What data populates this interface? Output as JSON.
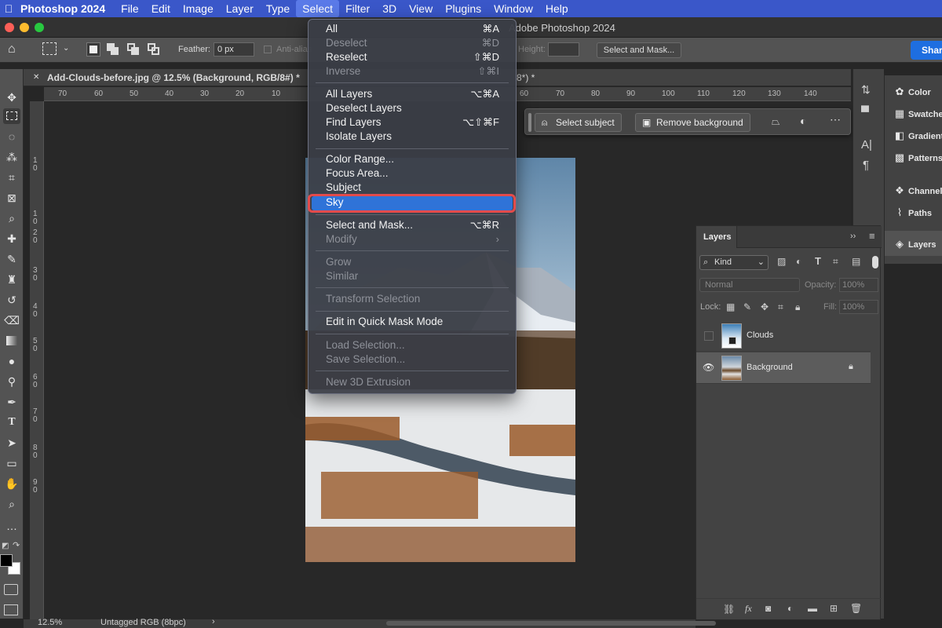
{
  "menubar": {
    "app_name": "Photoshop 2024",
    "items": [
      "File",
      "Edit",
      "Image",
      "Layer",
      "Type",
      "Select",
      "Filter",
      "3D",
      "View",
      "Plugins",
      "Window",
      "Help"
    ],
    "active": "Select"
  },
  "window": {
    "title": "Adobe Photoshop 2024"
  },
  "options_bar": {
    "feather_label": "Feather:",
    "feather_value": "0 px",
    "antialias_label": "Anti-alias",
    "height_label": "Height:",
    "select_mask_label": "Select and Mask...",
    "share_label": "Share"
  },
  "document": {
    "tab_title": "Add-Clouds-before.jpg @ 12.5% (Background, RGB/8#) *",
    "tab2_suffix": "8*) *"
  },
  "rulers": {
    "horizontal": [
      "70",
      "60",
      "50",
      "40",
      "30",
      "20",
      "10",
      "60",
      "70",
      "80",
      "90",
      "100",
      "110",
      "120",
      "130",
      "140"
    ],
    "vertical": [
      "1",
      "0",
      "1",
      "0",
      "2",
      "0",
      "3",
      "0",
      "4",
      "0",
      "5",
      "0",
      "6",
      "0",
      "7",
      "0",
      "8",
      "0",
      "9",
      "0"
    ]
  },
  "contextual_taskbar": {
    "select_subject": "Select subject",
    "remove_background": "Remove background"
  },
  "select_menu": {
    "items": [
      {
        "label": "All",
        "shortcut": "⌘A",
        "disabled": false
      },
      {
        "label": "Deselect",
        "shortcut": "⌘D",
        "disabled": true
      },
      {
        "label": "Reselect",
        "shortcut": "⇧⌘D",
        "disabled": false
      },
      {
        "label": "Inverse",
        "shortcut": "⇧⌘I",
        "disabled": true
      },
      {
        "label": "All Layers",
        "shortcut": "⌥⌘A",
        "disabled": false
      },
      {
        "label": "Deselect Layers",
        "shortcut": "",
        "disabled": false
      },
      {
        "label": "Find Layers",
        "shortcut": "⌥⇧⌘F",
        "disabled": false
      },
      {
        "label": "Isolate Layers",
        "shortcut": "",
        "disabled": false
      },
      {
        "label": "Color Range...",
        "shortcut": "",
        "disabled": false
      },
      {
        "label": "Focus Area...",
        "shortcut": "",
        "disabled": false
      },
      {
        "label": "Subject",
        "shortcut": "",
        "disabled": false
      },
      {
        "label": "Sky",
        "shortcut": "",
        "disabled": false,
        "highlighted": true
      },
      {
        "label": "Select and Mask...",
        "shortcut": "⌥⌘R",
        "disabled": false
      },
      {
        "label": "Modify",
        "shortcut": "›",
        "disabled": true
      },
      {
        "label": "Grow",
        "shortcut": "",
        "disabled": true
      },
      {
        "label": "Similar",
        "shortcut": "",
        "disabled": true
      },
      {
        "label": "Transform Selection",
        "shortcut": "",
        "disabled": true
      },
      {
        "label": "Edit in Quick Mask Mode",
        "shortcut": "",
        "disabled": false
      },
      {
        "label": "Load Selection...",
        "shortcut": "",
        "disabled": true
      },
      {
        "label": "Save Selection...",
        "shortcut": "",
        "disabled": true
      },
      {
        "label": "New 3D Extrusion",
        "shortcut": "",
        "disabled": true
      }
    ]
  },
  "right_panels": {
    "items": [
      "Color",
      "Swatches",
      "Gradients",
      "Patterns",
      "Channels",
      "Paths",
      "Layers"
    ]
  },
  "layers_panel": {
    "title": "Layers",
    "kind_label": "Kind",
    "blend_mode": "Normal",
    "opacity_label": "Opacity:",
    "opacity_value": "100%",
    "lock_label": "Lock:",
    "fill_label": "Fill:",
    "fill_value": "100%",
    "layers": [
      {
        "name": "Clouds",
        "visible": false
      },
      {
        "name": "Background",
        "visible": true,
        "locked": true
      }
    ]
  },
  "status_bar": {
    "zoom": "12.5%",
    "profile": "Untagged RGB (8bpc)"
  },
  "colors": {
    "menubar_bg": "#3a57c9",
    "menu_highlight": "#2f73d8",
    "annotation_red": "#e34b4b",
    "panel_bg": "#434343"
  }
}
